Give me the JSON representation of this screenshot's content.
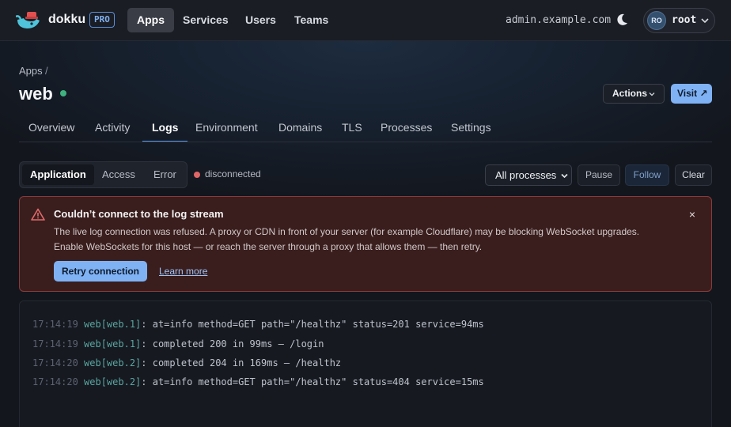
{
  "topbar": {
    "brand": "dokku",
    "badge": "PRO",
    "nav": [
      "Apps",
      "Services",
      "Users",
      "Teams"
    ],
    "active_nav": "Apps",
    "host": "admin.example.com",
    "user": {
      "initials": "RO",
      "name": "root"
    },
    "icons": {
      "logo": "whale-logo-icon",
      "theme": "moon-icon",
      "menu": "chevron-down-icon"
    }
  },
  "header": {
    "breadcrumb": "Apps",
    "breadcrumb_sep": "/",
    "app_name": "web",
    "status_color": "#3fb37f",
    "actions_label": "Actions",
    "visit_label": "Visit ↗"
  },
  "tabs": [
    "Overview",
    "Activity",
    "Logs",
    "Environment",
    "Domains",
    "TLS",
    "Processes",
    "Settings"
  ],
  "active_tab": "Logs",
  "logs_toolbar": {
    "sources": [
      "Application",
      "Access",
      "Error"
    ],
    "active_source": "Application",
    "connection_status": "disconnected",
    "connection_color": "#e06666",
    "process_filter": "All processes",
    "pause_label": "Pause",
    "follow_label": "Follow",
    "clear_label": "Clear"
  },
  "alert": {
    "title": "Couldn’t connect to the log stream",
    "body_line1": "The live log connection was refused. A proxy or CDN in front of your server (for example Cloudflare) may be blocking WebSocket upgrades.",
    "body_line2": "Enable WebSockets for this host — or reach the server through a proxy that allows them — then retry.",
    "close_label": "×",
    "retry_label": "Retry connection",
    "learn_more_label": "Learn more",
    "icon": "warning-triangle-icon"
  },
  "log_lines": [
    {
      "time": "17:14:19",
      "source": "web[web.1]",
      "message": ": at=info method=GET path=\"/healthz\" status=201 service=94ms"
    },
    {
      "time": "17:14:19",
      "source": "web[web.1]",
      "message": ": completed 200 in 99ms — /login"
    },
    {
      "time": "17:14:20",
      "source": "web[web.2]",
      "message": ": completed 204 in 169ms — /healthz"
    },
    {
      "time": "17:14:20",
      "source": "web[web.2]",
      "message": ": at=info method=GET path=\"/healthz\" status=404 service=15ms"
    }
  ]
}
